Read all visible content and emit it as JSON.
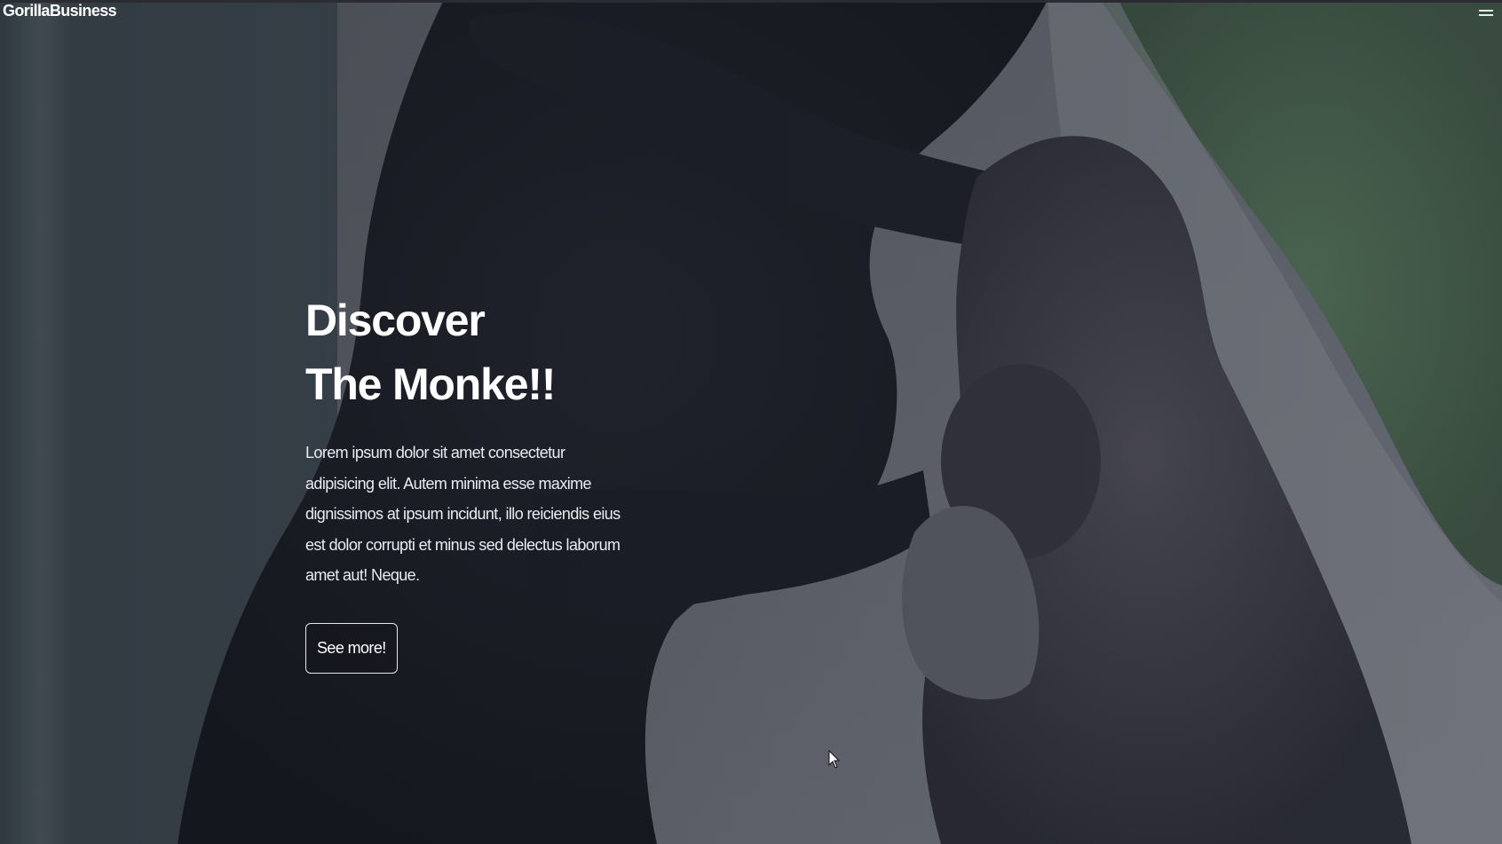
{
  "header": {
    "brand": "GorillaBusiness",
    "menu_icon": "hamburger-menu-icon"
  },
  "hero": {
    "title": "Discover The Monke!!",
    "description": "Lorem ipsum dolor sit amet consectetur adipisicing elit. Autem minima esse maxime dignissimos at ipsum incidunt, illo reiciendis eius est dolor corrupti et minus sed delectus laborum amet aut! Neque.",
    "cta_label": "See more!",
    "background_image": "gorilla-photo"
  },
  "colors": {
    "text_primary": "#ffffff",
    "text_secondary": "#e9ecef",
    "button_border": "#e6e8ea"
  }
}
